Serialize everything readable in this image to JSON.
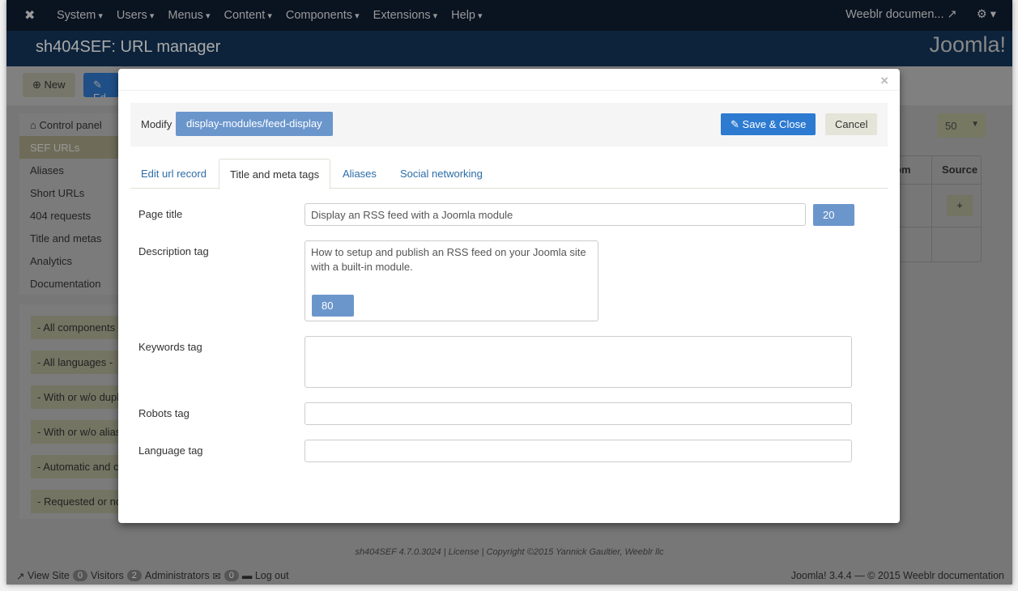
{
  "topnav": {
    "menus": [
      "System",
      "Users",
      "Menus",
      "Content",
      "Components",
      "Extensions",
      "Help"
    ],
    "site": "Weeblr documen...",
    "logo_icon": "joomla-icon",
    "settings_icon": "gear-icon"
  },
  "header": {
    "title": "sh404SEF: URL manager",
    "logo": "Joomla!"
  },
  "toolbar": {
    "new": "New",
    "edit": "Ed"
  },
  "sidebar": {
    "items": [
      "Control panel",
      "SEF URLs",
      "Aliases",
      "Short URLs",
      "404 requests",
      "Title and metas",
      "Analytics",
      "Documentation"
    ]
  },
  "filters": [
    "- All components",
    "- All languages -",
    "- With or w/o dupl",
    "- With or w/o alias",
    "- Automatic and c",
    "- Requested or no"
  ],
  "list": {
    "limit": "50",
    "col_partial": "om",
    "col_source": "Source",
    "source_btn": "+"
  },
  "footer": {
    "credits": "sh404SEF 4.7.0.3024 | License | Copyright ©2015 Yannick Gaultier, Weeblr llc",
    "view_site": "View Site",
    "visitors_count": "0",
    "visitors": "Visitors",
    "admins_count": "2",
    "admins": "Administrators",
    "messages_count": "0",
    "logout": "Log out",
    "version": "Joomla! 3.4.4 — © 2015 Weeblr documentation"
  },
  "modal": {
    "close": "×",
    "modify": "Modify",
    "url": "display-modules/feed-display",
    "save": "Save & Close",
    "cancel": "Cancel",
    "tabs": [
      "Edit url record",
      "Title and meta tags",
      "Aliases",
      "Social networking"
    ],
    "fields": {
      "page_title_label": "Page title",
      "page_title_value": "Display an RSS feed with a Joomla module",
      "page_title_count": "20",
      "desc_label": "Description tag",
      "desc_value": "How to setup and publish an RSS feed on your Joomla site with a built-in module.",
      "desc_count": "80",
      "keywords_label": "Keywords tag",
      "keywords_value": "",
      "robots_label": "Robots tag",
      "robots_value": "",
      "lang_label": "Language tag",
      "lang_value": ""
    }
  }
}
